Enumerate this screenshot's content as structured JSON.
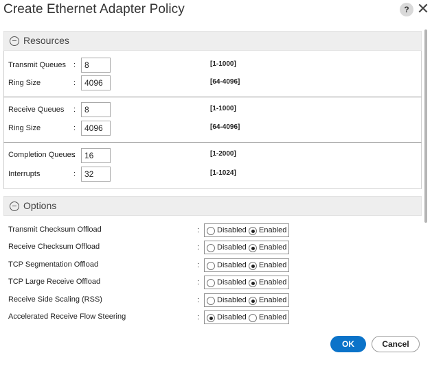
{
  "dialog": {
    "title": "Create Ethernet Adapter Policy",
    "help_label": "?",
    "close_label": "✕"
  },
  "resources": {
    "title": "Resources",
    "groups": [
      {
        "fields": [
          {
            "label": "Transmit Queues",
            "colon": ":",
            "value": "8",
            "range": "[1-1000]"
          },
          {
            "label": "Ring Size",
            "colon": ":",
            "value": "4096",
            "range": "[64-4096]"
          }
        ]
      },
      {
        "fields": [
          {
            "label": "Receive Queues",
            "colon": ":",
            "value": "8",
            "range": "[1-1000]"
          },
          {
            "label": "Ring Size",
            "colon": ":",
            "value": "4096",
            "range": "[64-4096]"
          }
        ]
      },
      {
        "fields": [
          {
            "label": "Completion Queues",
            "colon": ":",
            "value": "16",
            "range": "[1-2000]"
          },
          {
            "label": "Interrupts",
            "colon": ":",
            "value": "32",
            "range": "[1-1024]"
          }
        ]
      }
    ]
  },
  "options": {
    "title": "Options",
    "disabled_label": "Disabled",
    "enabled_label": "Enabled",
    "items": [
      {
        "label": "Transmit Checksum Offload",
        "colon": ":",
        "selected": "Enabled"
      },
      {
        "label": "Receive Checksum Offload",
        "colon": ":",
        "selected": "Enabled"
      },
      {
        "label": "TCP Segmentation Offload",
        "colon": ":",
        "selected": "Enabled"
      },
      {
        "label": "TCP Large Receive Offload",
        "colon": ":",
        "selected": "Enabled"
      },
      {
        "label": "Receive Side Scaling (RSS)",
        "colon": ":",
        "selected": "Enabled"
      },
      {
        "label": "Accelerated Receive Flow Steering",
        "colon": ":",
        "selected": "Disabled"
      }
    ]
  },
  "footer": {
    "ok_label": "OK",
    "cancel_label": "Cancel"
  },
  "colors": {
    "primary_button": "#0b73c9",
    "section_header_bg": "#eeeeee"
  }
}
